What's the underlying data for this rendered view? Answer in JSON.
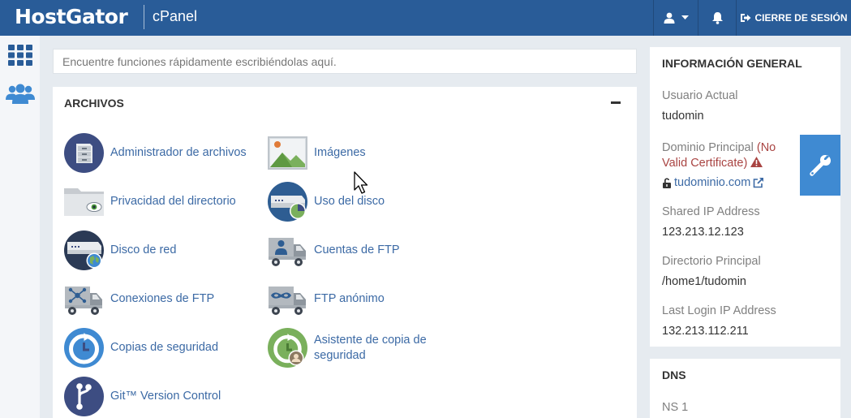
{
  "header": {
    "brand": "HostGator",
    "product": "cPanel",
    "logout_label": "CIERRE DE SESIÓN",
    "user_icon": "user-icon",
    "bell_icon": "bell-icon",
    "colors": {
      "bar": "#295c98",
      "accent": "#3f8ad2"
    }
  },
  "search": {
    "placeholder": "Encuentre funciones rápidamente escribiéndolas aquí."
  },
  "files_section": {
    "title": "ARCHIVOS",
    "apps": [
      {
        "label": "Administrador de archivos",
        "icon": "file-manager-icon"
      },
      {
        "label": "Imágenes",
        "icon": "images-icon"
      },
      {
        "label": "Privacidad del directorio",
        "icon": "directory-privacy-icon"
      },
      {
        "label": "Uso del disco",
        "icon": "disk-usage-icon"
      },
      {
        "label": "Disco de red",
        "icon": "web-disk-icon"
      },
      {
        "label": "Cuentas de FTP",
        "icon": "ftp-accounts-icon"
      },
      {
        "label": "Conexiones de FTP",
        "icon": "ftp-connections-icon"
      },
      {
        "label": "FTP anónimo",
        "icon": "anonymous-ftp-icon"
      },
      {
        "label": "Copias de seguridad",
        "icon": "backup-icon"
      },
      {
        "label": "Asistente de copia de seguridad",
        "icon": "backup-wizard-icon"
      },
      {
        "label": "Git™ Version Control",
        "icon": "git-icon"
      }
    ]
  },
  "general_info": {
    "title": "INFORMACIÓN GENERAL",
    "current_user_label": "Usuario Actual",
    "current_user": "tudomin",
    "main_domain_label": "Dominio Principal",
    "cert_warning": "(No Valid Certificate)",
    "main_domain": "tudominio.com",
    "shared_ip_label": "Shared IP Address",
    "shared_ip": "123.213.12.123",
    "home_dir_label": "Directorio Principal",
    "home_dir": "/home1/tudomin",
    "last_login_label": "Last Login IP Address",
    "last_login_ip": "132.213.112.211"
  },
  "dns": {
    "title": "DNS",
    "ns1_label": "NS 1"
  }
}
